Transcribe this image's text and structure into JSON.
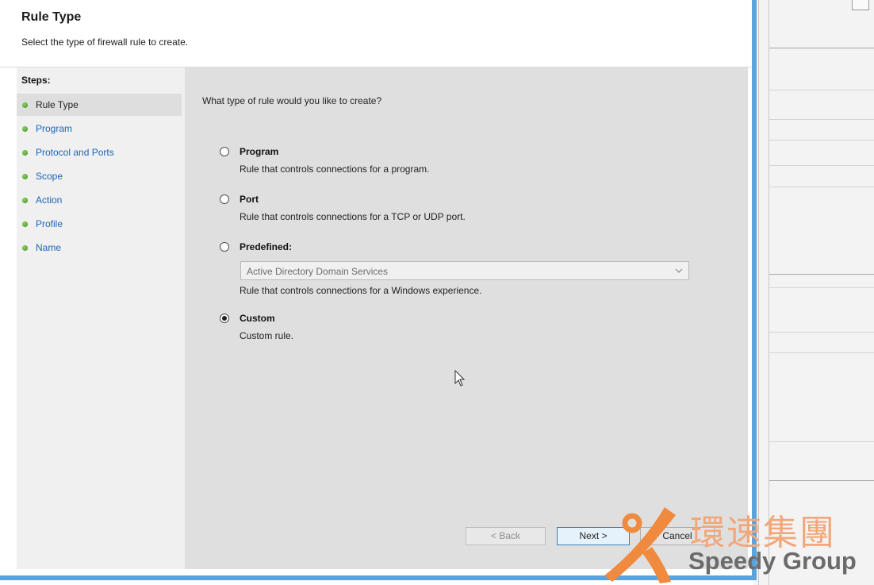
{
  "header": {
    "title": "Rule Type",
    "subtitle": "Select the type of firewall rule to create."
  },
  "steps": {
    "label": "Steps:",
    "items": [
      {
        "label": "Rule Type",
        "active": true
      },
      {
        "label": "Program"
      },
      {
        "label": "Protocol and Ports"
      },
      {
        "label": "Scope"
      },
      {
        "label": "Action"
      },
      {
        "label": "Profile"
      },
      {
        "label": "Name"
      }
    ]
  },
  "content": {
    "question": "What type of rule would you like to create?",
    "options": [
      {
        "name": "Program",
        "desc": "Rule that controls connections for a program.",
        "checked": false
      },
      {
        "name": "Port",
        "desc": "Rule that controls connections for a TCP or UDP port.",
        "checked": false
      },
      {
        "name": "Predefined:",
        "desc": "Rule that controls connections for a Windows experience.",
        "checked": false
      },
      {
        "name": "Custom",
        "desc": "Custom rule.",
        "checked": true
      }
    ],
    "predefined_select": {
      "value": "Active Directory Domain Services",
      "icon": "chevron-down-icon"
    }
  },
  "buttons": {
    "back": "< Back",
    "next": "Next >",
    "cancel": "Cancel"
  },
  "watermark": {
    "chinese": "環速集團",
    "english": "Speedy Group"
  },
  "colors": {
    "accent_border": "#5aa3db",
    "link": "#1c64b4",
    "watermark_orange": "#f08a3e"
  }
}
